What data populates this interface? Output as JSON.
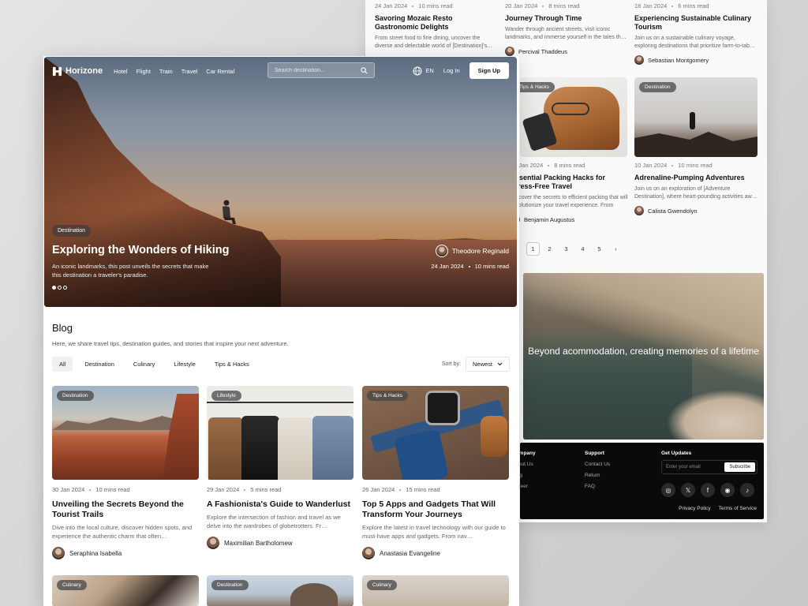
{
  "back": {
    "top_cards": [
      {
        "date": "24 Jan 2024",
        "read": "10 mins read",
        "title": "Savoring Mozaic Resto Gastronomic Delights",
        "excerpt": "From street food to fine dining, uncover the diverse and delectable world of [Destination]'s…",
        "author": ""
      },
      {
        "date": "20 Jan 2024",
        "read": "8 mins read",
        "title": "Journey Through Time",
        "excerpt": "Wander through ancient streets, visit iconic landmarks, and immerse yourself in the tales th…",
        "author": "Percival Thaddeus"
      },
      {
        "date": "18 Jan 2024",
        "read": "6 mins read",
        "title": "Experiencing Sustainable Culinary Tourism",
        "excerpt": "Join us on a sustainable culinary voyage, exploring destinations that prioritize farm-to-tab…",
        "author": "Sebastian Montgomery"
      }
    ],
    "mid_cards": [
      {
        "tag": "Tips & Hacks",
        "date": "24 Jan 2024",
        "read": "8 mins read",
        "title": "Essential Packing Hacks for Stress-Free Travel",
        "excerpt": "Discover the secrets to efficient packing that will revolutionize your travel experience. From maxi…",
        "author": "Benjamin Augustus"
      },
      {
        "tag": "Destination",
        "date": "10 Jan 2024",
        "read": "10 mins read",
        "title": "Adrenaline-Pumping Adventures",
        "excerpt": "Join us on an exploration of [Adventure Destination], where heart-pounding activities aw…",
        "author": "Calista Gwendolyn"
      }
    ],
    "pagination": [
      "1",
      "2",
      "3",
      "4",
      "5",
      "›"
    ],
    "hero_caption": "Beyond acommodation, creating memories of a lifetime",
    "footer": {
      "company": {
        "heading": "Company",
        "links": [
          "About Us",
          "Blog",
          "Career"
        ]
      },
      "support": {
        "heading": "Support",
        "links": [
          "Contact Us",
          "Return",
          "FAQ"
        ]
      },
      "updates_heading": "Get Updates",
      "email_placeholder": "Enter your email",
      "subscribe_label": "Subscribe",
      "socials": [
        "◎",
        "𝕏",
        "f",
        "◉",
        "♪"
      ],
      "privacy": "Privacy Policy",
      "terms": "Terms  of Service"
    }
  },
  "front": {
    "nav": {
      "brand": "Horizone",
      "menu": [
        "Hotel",
        "Flight",
        "Train",
        "Travel",
        "Car Rental"
      ],
      "search_placeholder": "Search destination...",
      "lang": "EN",
      "login": "Log In",
      "signup": "Sign Up"
    },
    "hero": {
      "tag": "Destination",
      "title": "Exploring the Wonders of Hiking",
      "description": "An iconic landmarks, this post unveils the secrets that make this destination a traveler's paradise.",
      "author": "Theodore Reginald",
      "date": "24 Jan 2024",
      "read": "10 mins read"
    },
    "blog": {
      "title": "Blog",
      "subtitle": "Here, we share travel tips, destination guides, and stories that inspire your next adventure.",
      "filters": [
        "All",
        "Destination",
        "Culinary",
        "Lifestyle",
        "Tips & Hacks"
      ],
      "sort_label": "Sort by:",
      "sort_value": "Newest"
    },
    "cards": [
      {
        "tag": "Destination",
        "date": "30 Jan 2024",
        "read": "10 mins read",
        "title": "Unveiling the Secrets Beyond the Tourist Trails",
        "excerpt": "Dive into the local culture, discover hidden spots, and experience the authentic charm that often…",
        "author": "Seraphina Isabella"
      },
      {
        "tag": "Lifestyle",
        "date": "29 Jan 2024",
        "read": "5 mins read",
        "title": "A Fashionista's Guide to Wanderlust",
        "excerpt": "Explore the intersection of fashion and travel as we delve into the wardrobes of globetrotters. Fr…",
        "author": "Maximilian Bartholomew"
      },
      {
        "tag": "Tips & Hacks",
        "date": "26 Jan 2024",
        "read": "15 mins read",
        "title": "Top 5 Apps and Gadgets That Will Transform Your Journeys",
        "excerpt": "Explore the latest in travel technology with our guide to must-have apps and gadgets. From nav…",
        "author": "Anastasia Evangeline"
      }
    ],
    "row2_tags": [
      "Culinary",
      "Destination",
      "Culinary"
    ]
  },
  "colors": {
    "accent": "#0a0a0a",
    "background": "#ffffff",
    "muted": "#666666"
  }
}
